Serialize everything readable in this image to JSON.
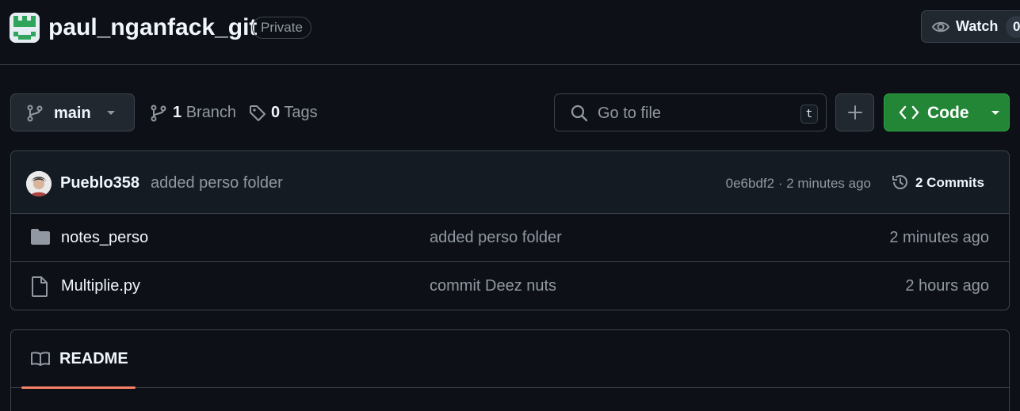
{
  "header": {
    "repo_name": "paul_nganfack_git",
    "visibility_badge": "Private",
    "watch_label": "Watch",
    "watch_count": "0"
  },
  "toolbar": {
    "branch_name": "main",
    "branch_count": "1",
    "branch_label": "Branch",
    "tag_count": "0",
    "tag_label": "Tags",
    "search_placeholder": "Go to file",
    "search_shortcut": "t",
    "code_label": "Code"
  },
  "latest_commit": {
    "author": "Pueblo358",
    "message": "added perso folder",
    "sha_time": "0e6bdf2 · 2 minutes ago",
    "commits_label": "2 Commits"
  },
  "files": [
    {
      "type": "folder",
      "name": "notes_perso",
      "message": "added perso folder",
      "time": "2 minutes ago"
    },
    {
      "type": "file",
      "name": "Multiplie.py",
      "message": "commit Deez nuts",
      "time": "2 hours ago"
    }
  ],
  "readme": {
    "tab_label": "README"
  },
  "colors": {
    "background": "#0d1117",
    "accent_green": "#238636",
    "tab_underline": "#f78166"
  }
}
